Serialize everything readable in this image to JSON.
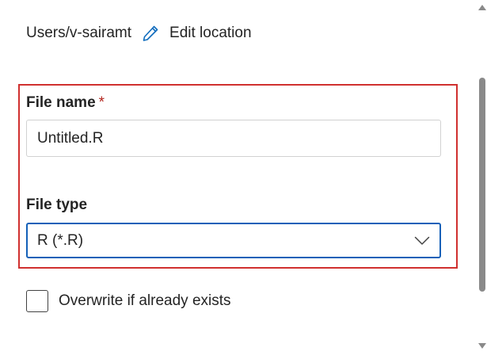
{
  "location": {
    "path": "Users/v-sairamt",
    "edit_label": "Edit location",
    "edit_icon": "pencil-icon"
  },
  "file_name": {
    "label": "File name",
    "required_marker": "*",
    "value": "Untitled.R"
  },
  "file_type": {
    "label": "File type",
    "selected": "R (*.R)",
    "dropdown_icon": "chevron-down-icon"
  },
  "overwrite": {
    "label": "Overwrite if already exists",
    "checked": false
  },
  "colors": {
    "highlight_border": "#d0302f",
    "focus_border": "#1460b8",
    "required_star": "#b3261e"
  }
}
